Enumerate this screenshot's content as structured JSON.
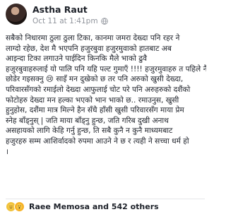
{
  "post": {
    "author": "Astha Raut",
    "timestamp": "Oct 11 at 1:41pm",
    "privacy_icon": "globe-icon",
    "text_lines": [
      "सबैको निधारमा ठुला ठुला टिका, कानमा जमरा देख्दा पनि रहर ने",
      "लाग्दो रहेछ, देश मै भएपनि हजुरबुवा हजुरमुवाको हातबाट अब",
      "आइन्दा टिका लगाउने पाईदिन किनकि मैले भाको ढुवै",
      "हजुरबुवाहरुलाई यो पालि पनि यहि पल्ट गुमाएँ !!!! हजुरमुवाहरु त पहिले नै",
      "छोडेर गइसक्नु 😢 साइँ मन दुखेको छ तर पनि अरुको खुसी देख्दा,",
      "परिवारसँगको रमाईलो देख्दा आफुलाई चोट परे पनि अरुहरुको दशैंको",
      "फोटोहरु देख्दा मन हल्का भएको भान भाको छ.. रमाउनुस, खुसी",
      "हुनुहोस, दशैंमा मात्र मिल्ने हैन सँधै हाँसी खुसी परिवारसँग माया प्रेम",
      "स्नेह बाँड्नुस् | जति माया बाँड्नु हुन्छ, जति गरिब दुखी अनाथ",
      "असहायको लागि केहि गर्नु हुन्छ, ति सबै कुनै न कुनै माध्यमबाट",
      "हजुरहरु सम्म आशिर्वादको रुपमा आउने ने छ र त्यही ने सच्चा धर्म हो",
      "।"
    ]
  },
  "reactions": {
    "icons": [
      "like-icon",
      "wow-icon"
    ],
    "summary": "Raee Memosa and 542 others"
  }
}
